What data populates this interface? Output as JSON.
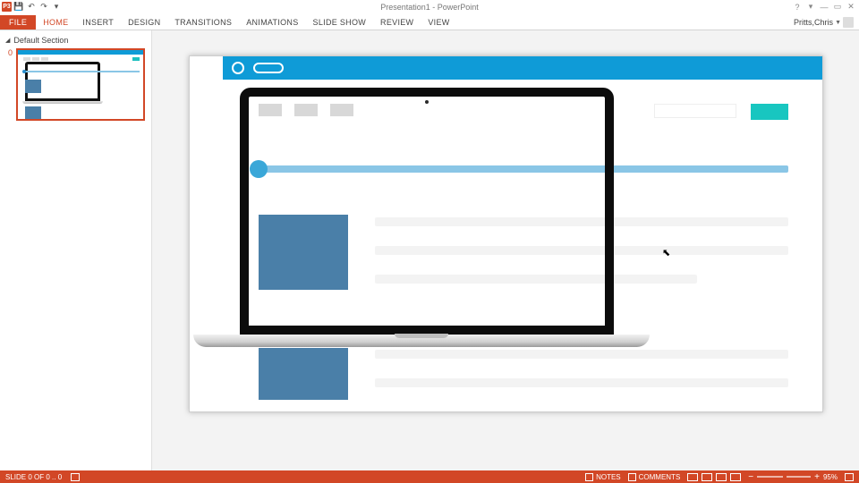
{
  "app": {
    "doc_title": "Presentation1 - PowerPoint"
  },
  "qat": {
    "app_abbrev": "P3"
  },
  "win": {
    "help": "?",
    "min": "—",
    "max": "▭",
    "close": "✕",
    "opts": "▾"
  },
  "tabs": {
    "file": "FILE",
    "items": [
      "HOME",
      "INSERT",
      "DESIGN",
      "TRANSITIONS",
      "ANIMATIONS",
      "SLIDE SHOW",
      "REVIEW",
      "VIEW"
    ],
    "active_index": 0
  },
  "user": {
    "name": "Pritts,Chris"
  },
  "panel": {
    "section_label": "Default Section",
    "slide_number": "0"
  },
  "status": {
    "left": "SLIDE 0 OF 0 .. 0",
    "notes": "NOTES",
    "comments": "COMMENTS",
    "zoom_pct": "95%",
    "zoom_slider_pos_pct": 48
  },
  "colors": {
    "brand": "#d24726",
    "header_blue": "#0f9bd7",
    "track_blue": "#8ac6e6",
    "handle_blue": "#3aa7d8",
    "card_blue": "#4a7fa8",
    "teal": "#18c6c0"
  }
}
